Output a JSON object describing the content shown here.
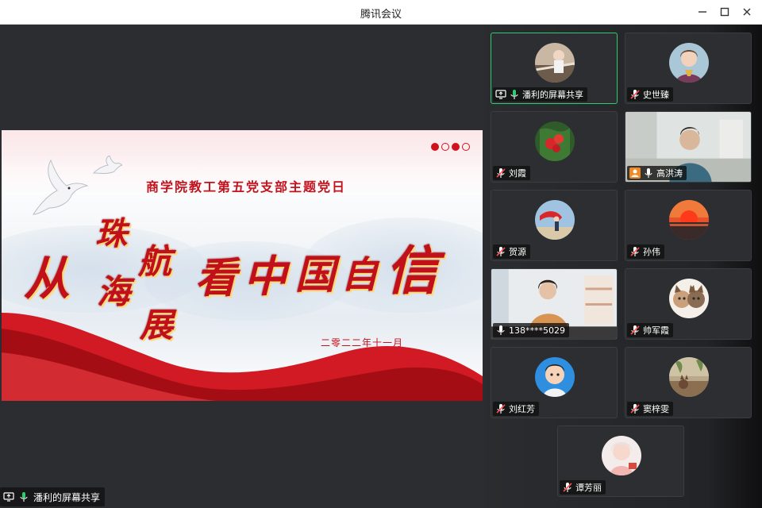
{
  "window": {
    "title": "腾讯会议"
  },
  "slide": {
    "subtitle": "商学院教工第五党支部主题党日",
    "calligraphy": {
      "c1": "从",
      "c2": "珠",
      "c3": "航",
      "c4": "海",
      "c5": "展",
      "c6": "看",
      "c7": "中",
      "c8": "国",
      "c9": "自",
      "c10": "信"
    },
    "date": "二零二二年十一月"
  },
  "share_label": "潘利的屏幕共享",
  "colors": {
    "accent_red": "#c3121c",
    "active_border": "#2ecc71",
    "mic_on": "#2ecc71",
    "mic_muted": "#ff4d4f"
  },
  "participants": [
    {
      "name": "潘利的屏幕共享",
      "mic": "on",
      "share_icon": true,
      "active": true
    },
    {
      "name": "史世臻",
      "mic": "muted"
    },
    {
      "name": "刘霞",
      "mic": "muted"
    },
    {
      "name": "高洪涛",
      "mic": "on",
      "host_icon": true,
      "video": true
    },
    {
      "name": "贺源",
      "mic": "muted"
    },
    {
      "name": "孙伟",
      "mic": "muted"
    },
    {
      "name": "138****5029",
      "mic": "on",
      "video": true
    },
    {
      "name": "帅军霞",
      "mic": "muted"
    },
    {
      "name": "刘红芳",
      "mic": "muted"
    },
    {
      "name": "窦梓雯",
      "mic": "muted"
    },
    {
      "name": "谭芳丽",
      "mic": "muted"
    }
  ]
}
